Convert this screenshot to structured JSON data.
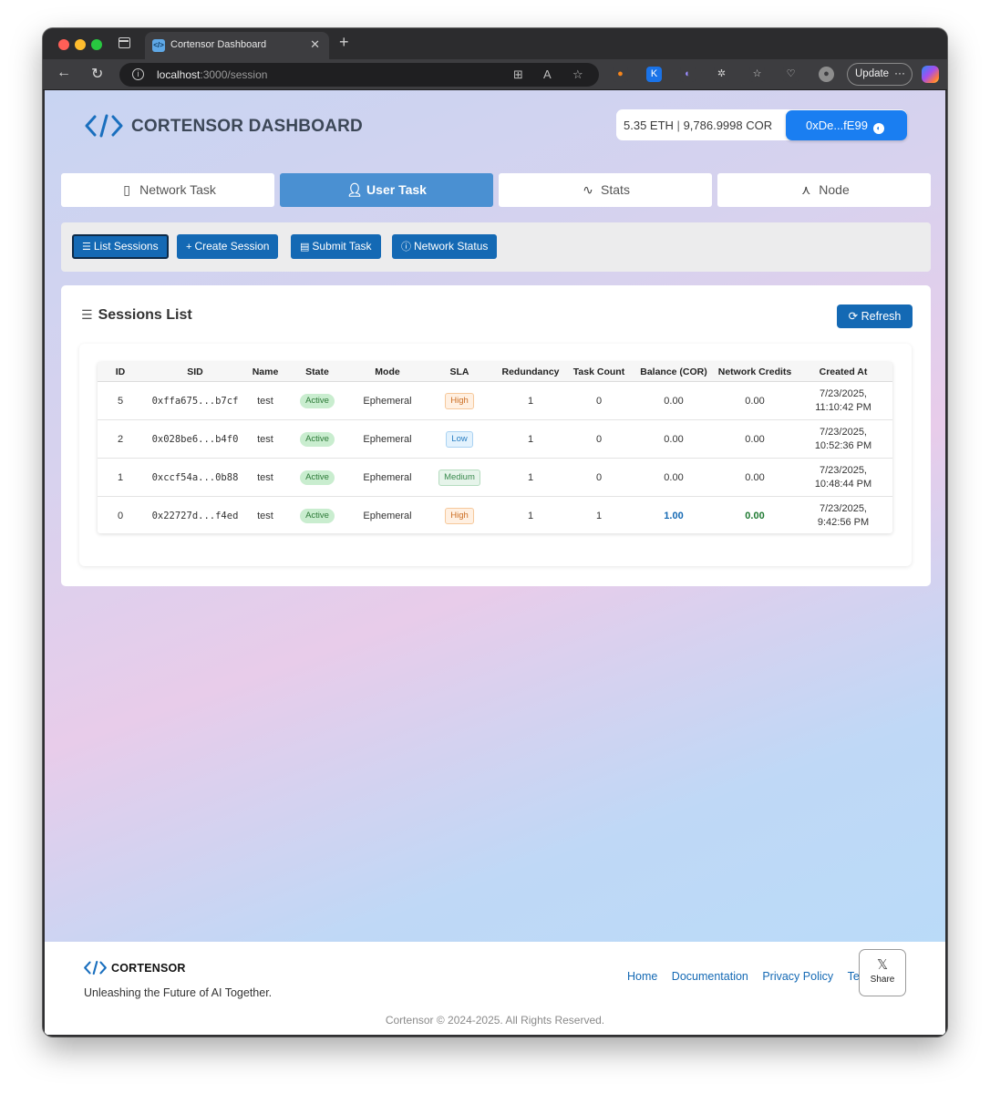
{
  "browser": {
    "tab_title": "Cortensor Dashboard",
    "tab_favicon": "</>",
    "url_host": "localhost",
    "url_path": ":3000/session",
    "update_label": "Update",
    "extensions": [
      {
        "name": "metamask-extension-icon",
        "color": "#f6851b",
        "glyph": "🦊"
      },
      {
        "name": "k-extension-icon",
        "color": "#1a73e8",
        "glyph": "K"
      },
      {
        "name": "swirl-extension-icon",
        "color": "#7b61ff",
        "glyph": "∞"
      }
    ]
  },
  "header": {
    "brand_title": "CORTENSOR DASHBOARD",
    "wallet_balance_eth": "5.35 ETH",
    "wallet_separator": "|",
    "wallet_balance_cor": "9,786.9998 COR",
    "wallet_address": "0xDe...fE99"
  },
  "nav_tabs": [
    {
      "label": "Network Task",
      "icon": "book-icon"
    },
    {
      "label": "User Task",
      "icon": "user-icon"
    },
    {
      "label": "Stats",
      "icon": "activity-icon"
    },
    {
      "label": "Node",
      "icon": "nodes-icon"
    }
  ],
  "actions": {
    "list_sessions": "List Sessions",
    "create_session": "Create Session",
    "submit_task": "Submit Task",
    "network_status": "Network Status"
  },
  "sessions": {
    "title": "Sessions List",
    "refresh_label": "Refresh",
    "columns": [
      "ID",
      "SID",
      "Name",
      "State",
      "Mode",
      "SLA",
      "Redundancy",
      "Task Count",
      "Balance (COR)",
      "Network Credits",
      "Created At"
    ],
    "rows": [
      {
        "id": "5",
        "sid": "0xffa675...b7cf",
        "name": "test",
        "state": "Active",
        "mode": "Ephemeral",
        "sla": "High",
        "redundancy": "1",
        "task_count": "0",
        "balance": "0.00",
        "credits": "0.00",
        "created_date": "7/23/2025,",
        "created_time": "11:10:42 PM"
      },
      {
        "id": "2",
        "sid": "0x028be6...b4f0",
        "name": "test",
        "state": "Active",
        "mode": "Ephemeral",
        "sla": "Low",
        "redundancy": "1",
        "task_count": "0",
        "balance": "0.00",
        "credits": "0.00",
        "created_date": "7/23/2025,",
        "created_time": "10:52:36 PM"
      },
      {
        "id": "1",
        "sid": "0xccf54a...0b88",
        "name": "test",
        "state": "Active",
        "mode": "Ephemeral",
        "sla": "Medium",
        "redundancy": "1",
        "task_count": "0",
        "balance": "0.00",
        "credits": "0.00",
        "created_date": "7/23/2025,",
        "created_time": "10:48:44 PM"
      },
      {
        "id": "0",
        "sid": "0x22727d...f4ed",
        "name": "test",
        "state": "Active",
        "mode": "Ephemeral",
        "sla": "High",
        "redundancy": "1",
        "task_count": "1",
        "balance": "1.00",
        "credits": "0.00",
        "created_date": "7/23/2025,",
        "created_time": "9:42:56 PM"
      }
    ]
  },
  "footer": {
    "brand_name": "CORTENSOR",
    "tagline": "Unleashing the Future of AI Together.",
    "links": [
      "Home",
      "Documentation",
      "Privacy Policy",
      "Terms"
    ],
    "share_label": "Share",
    "copyright": "Cortensor © 2024-2025. All Rights Reserved."
  },
  "colors": {
    "primary": "#1469b4",
    "tab_active": "#4a90d2",
    "wallet_button": "#1a7ef1"
  }
}
